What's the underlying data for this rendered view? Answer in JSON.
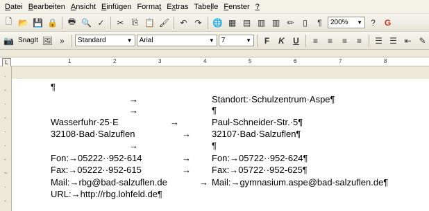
{
  "menu": [
    "Datei",
    "Bearbeiten",
    "Ansicht",
    "Einfügen",
    "Format",
    "Extras",
    "Tabelle",
    "Fenster",
    "?"
  ],
  "menu_underline": [
    "D",
    "B",
    "A",
    "E",
    "t",
    "x",
    "l",
    "F",
    "?"
  ],
  "toolbar1": {
    "zoom": "200%",
    "icons": [
      "new-document-icon",
      "open-folder-icon",
      "save-icon",
      "permission-icon",
      "print-icon",
      "print-preview-icon",
      "spelling-icon",
      "cut-icon",
      "copy-icon",
      "paste-icon",
      "format-painter-icon",
      "undo-icon",
      "redo-icon",
      "hyperlink-icon",
      "tables-borders-icon",
      "insert-table-icon",
      "insert-excel-icon",
      "columns-icon",
      "drawing-icon",
      "document-map-icon",
      "show-formatting-icon",
      "help-icon",
      "research-icon"
    ]
  },
  "toolbar2": {
    "snagit": "SnagIt",
    "style": "Standard",
    "font": "Arial",
    "size": "7",
    "bold": "F",
    "italic": "K",
    "underline": "U"
  },
  "ruler_numbers": [
    "1",
    "2",
    "3",
    "4",
    "5",
    "6",
    "7",
    "8"
  ],
  "document": {
    "lines": [
      {
        "text": "¶"
      },
      {
        "left": "→",
        "right": "Standort:·Schulzentrum·Aspe¶"
      },
      {
        "left": "→",
        "right": "¶"
      },
      {
        "left": "Wasserfuhr·25·E",
        "arrow": "→",
        "right": "Paul-Schneider-Str.·5¶"
      },
      {
        "left": "32108·Bad·Salzuflen",
        "arrow": "→",
        "right": "32107·Bad·Salzuflen¶"
      },
      {
        "left": "→",
        "right": "¶"
      },
      {
        "left": "Fon:→05222··952-614",
        "arrow": "→",
        "right": "Fon:→05722··952-624¶"
      },
      {
        "left": "Fax:→05222··952-615",
        "arrow": "→",
        "right": "Fax:→05722··952-625¶"
      },
      {
        "left": "Mail:→rbg@bad-salzuflen.de",
        "arrow": "→",
        "right": "Mail:→gymnasium.aspe@bad-salzuflen.de¶"
      },
      {
        "left": "URL:→http://rbg.lohfeld.de¶"
      }
    ]
  }
}
